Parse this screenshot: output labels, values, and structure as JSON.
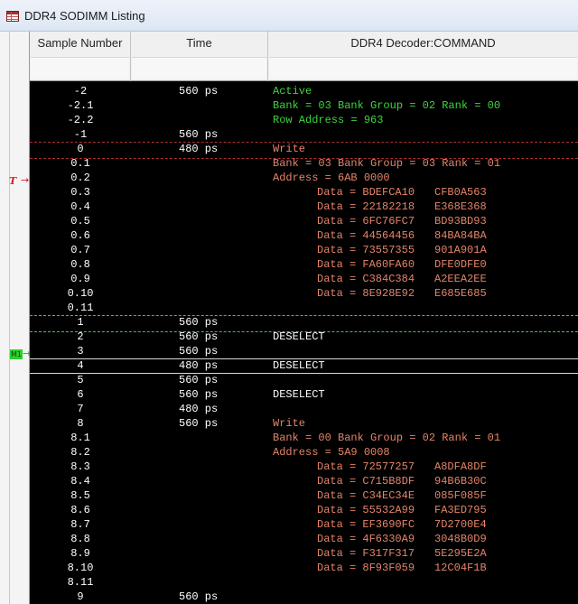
{
  "window": {
    "title": "DDR4 SODIMM Listing"
  },
  "markers": {
    "trigger": "T",
    "m1": "M1",
    "arrow": "→"
  },
  "columns": {
    "sample": "Sample Number",
    "time": "Time",
    "command": "DDR4 Decoder:COMMAND"
  },
  "colors": {
    "green": "#3fd43f",
    "orange": "#e4846a",
    "background": "#000000"
  },
  "rows": [
    {
      "s": "-2",
      "t": "560 ps",
      "c": "Active",
      "k": "green"
    },
    {
      "s": "-2.1",
      "t": "",
      "c": "Bank = 03 Bank Group = 02 Rank = 00",
      "k": "green"
    },
    {
      "s": "-2.2",
      "t": "",
      "c": "Row Address = 963",
      "k": "green"
    },
    {
      "s": "-1",
      "t": "560 ps",
      "c": "",
      "k": ""
    },
    {
      "s": "0",
      "t": "480 ps",
      "c": "Write",
      "k": "orange"
    },
    {
      "s": "0.1",
      "t": "",
      "c": "Bank = 03 Bank Group = 03 Rank = 01",
      "k": "orange"
    },
    {
      "s": "0.2",
      "t": "",
      "c": "Address = 6AB 0000",
      "k": "orange"
    },
    {
      "s": "0.3",
      "t": "",
      "c": "Data = BDEFCA10",
      "d2": "CFB0A563",
      "k": "orange",
      "i": true
    },
    {
      "s": "0.4",
      "t": "",
      "c": "Data = 22182218",
      "d2": "E368E368",
      "k": "orange",
      "i": true
    },
    {
      "s": "0.5",
      "t": "",
      "c": "Data = 6FC76FC7",
      "d2": "BD93BD93",
      "k": "orange",
      "i": true
    },
    {
      "s": "0.6",
      "t": "",
      "c": "Data = 44564456",
      "d2": "84BA84BA",
      "k": "orange",
      "i": true
    },
    {
      "s": "0.7",
      "t": "",
      "c": "Data = 73557355",
      "d2": "901A901A",
      "k": "orange",
      "i": true
    },
    {
      "s": "0.8",
      "t": "",
      "c": "Data = FA60FA60",
      "d2": "DFE0DFE0",
      "k": "orange",
      "i": true
    },
    {
      "s": "0.9",
      "t": "",
      "c": "Data = C384C384",
      "d2": "A2EEA2EE",
      "k": "orange",
      "i": true
    },
    {
      "s": "0.10",
      "t": "",
      "c": "Data = 8E928E92",
      "d2": "E685E685",
      "k": "orange",
      "i": true
    },
    {
      "s": "0.11",
      "t": "",
      "c": "",
      "k": ""
    },
    {
      "s": "1",
      "t": "560 ps",
      "c": "",
      "k": ""
    },
    {
      "s": "2",
      "t": "560 ps",
      "c": "DESELECT",
      "k": "white"
    },
    {
      "s": "3",
      "t": "560 ps",
      "c": "",
      "k": ""
    },
    {
      "s": "4",
      "t": "480 ps",
      "c": "DESELECT",
      "k": "white"
    },
    {
      "s": "5",
      "t": "560 ps",
      "c": "",
      "k": ""
    },
    {
      "s": "6",
      "t": "560 ps",
      "c": "DESELECT",
      "k": "white"
    },
    {
      "s": "7",
      "t": "480 ps",
      "c": "",
      "k": ""
    },
    {
      "s": "8",
      "t": "560 ps",
      "c": "Write",
      "k": "orange"
    },
    {
      "s": "8.1",
      "t": "",
      "c": "Bank = 00 Bank Group = 02 Rank = 01",
      "k": "orange"
    },
    {
      "s": "8.2",
      "t": "",
      "c": "Address = 5A9 0008",
      "k": "orange"
    },
    {
      "s": "8.3",
      "t": "",
      "c": "Data = 72577257",
      "d2": "A8DFA8DF",
      "k": "orange",
      "i": true
    },
    {
      "s": "8.4",
      "t": "",
      "c": "Data = C715B8DF",
      "d2": "94B6B30C",
      "k": "orange",
      "i": true
    },
    {
      "s": "8.5",
      "t": "",
      "c": "Data = C34EC34E",
      "d2": "085F085F",
      "k": "orange",
      "i": true
    },
    {
      "s": "8.6",
      "t": "",
      "c": "Data = 55532A99",
      "d2": "FA3ED795",
      "k": "orange",
      "i": true
    },
    {
      "s": "8.7",
      "t": "",
      "c": "Data = EF3690FC",
      "d2": "7D2700E4",
      "k": "orange",
      "i": true
    },
    {
      "s": "8.8",
      "t": "",
      "c": "Data = 4F6330A9",
      "d2": "3048B0D9",
      "k": "orange",
      "i": true
    },
    {
      "s": "8.9",
      "t": "",
      "c": "Data = F317F317",
      "d2": "5E295E2A",
      "k": "orange",
      "i": true
    },
    {
      "s": "8.10",
      "t": "",
      "c": "Data = 8F93F059",
      "d2": "12C04F1B",
      "k": "orange",
      "i": true
    },
    {
      "s": "8.11",
      "t": "",
      "c": "",
      "k": ""
    },
    {
      "s": "9",
      "t": "560 ps",
      "c": "",
      "k": ""
    }
  ]
}
